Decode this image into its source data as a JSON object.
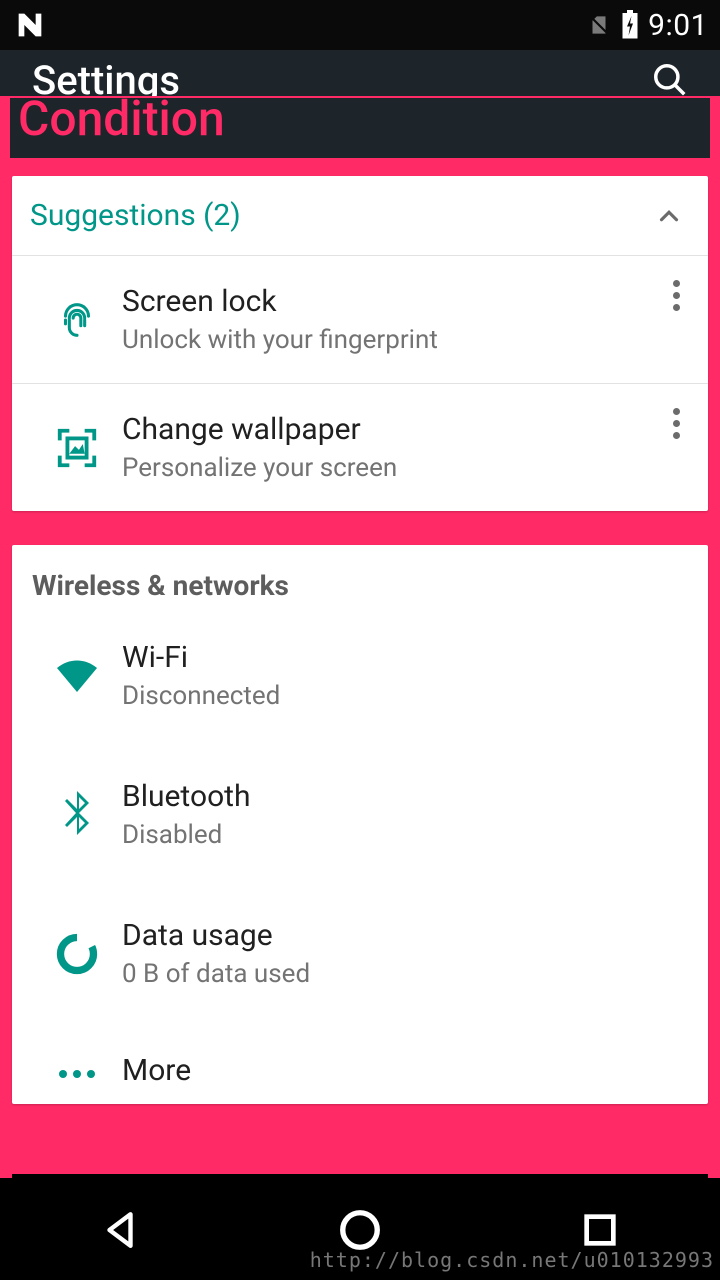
{
  "status": {
    "time": "9:01"
  },
  "app": {
    "title": "Settings"
  },
  "overlay": {
    "title": "Condition"
  },
  "suggestions": {
    "header": "Suggestions (2)",
    "items": [
      {
        "title": "Screen lock",
        "subtitle": "Unlock with your fingerprint",
        "icon": "fingerprint-icon"
      },
      {
        "title": "Change wallpaper",
        "subtitle": "Personalize your screen",
        "icon": "wallpaper-icon"
      }
    ]
  },
  "wireless": {
    "header": "Wireless & networks",
    "items": [
      {
        "title": "Wi-Fi",
        "subtitle": "Disconnected",
        "icon": "wifi-icon"
      },
      {
        "title": "Bluetooth",
        "subtitle": "Disabled",
        "icon": "bluetooth-icon"
      },
      {
        "title": "Data usage",
        "subtitle": "0 B of data used",
        "icon": "data-usage-icon"
      },
      {
        "title": "More",
        "subtitle": "",
        "icon": "more-icon"
      }
    ]
  },
  "watermark": "http://blog.csdn.net/u010132993",
  "colors": {
    "teal": "#009688",
    "overlay": "#ff2a66",
    "appbar": "#1d252b"
  }
}
